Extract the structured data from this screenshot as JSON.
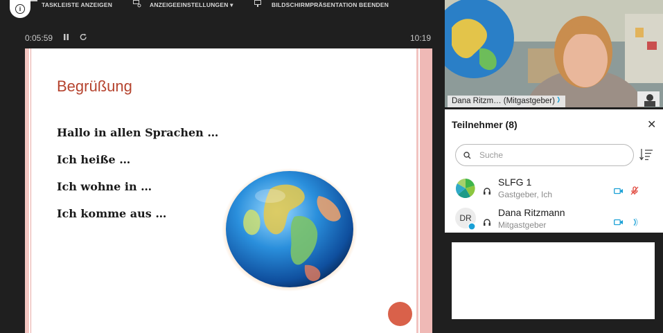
{
  "toolbar": {
    "show_taskbar": "TASKLEISTE ANZEIGEN",
    "display_settings": "ANZEIGEEINSTELLUNGEN ▾",
    "end_slideshow": "BILDSCHIRMPRÄSENTATION BEENDEN"
  },
  "player": {
    "elapsed": "0:05:59",
    "clock": "10:19"
  },
  "slide": {
    "title": "Begrüßung",
    "lines": [
      "Hallo in allen Sprachen …",
      "Ich heiße …",
      "Ich wohne in …",
      "Ich komme aus …"
    ]
  },
  "video": {
    "caption": "Dana Ritzm… (Mitgastgeber)"
  },
  "participants": {
    "title": "Teilnehmer (8)",
    "search_placeholder": "Suche",
    "list": [
      {
        "name": "SLFG 1",
        "role": "Gastgeber, Ich",
        "avatar": "logo-icon",
        "mic": "muted"
      },
      {
        "name": "Dana Ritzmann",
        "role": "Mitgastgeber",
        "avatar_initials": "DR",
        "mic": "speaking"
      }
    ]
  },
  "colors": {
    "accent": "#1aa0d6",
    "muted_red": "#e0453a",
    "title_red": "#b5432e"
  }
}
